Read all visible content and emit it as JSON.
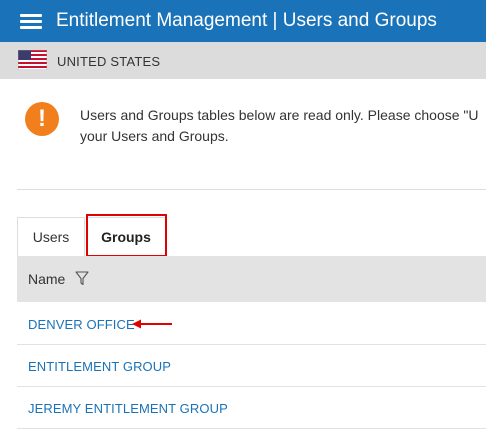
{
  "header": {
    "title": "Entitlement Management | Users and Groups",
    "background_color": "#1a73b8",
    "menu_icon": "hamburger-icon"
  },
  "region": {
    "flag_icon": "us-flag-icon",
    "label": "UNITED STATES"
  },
  "notice": {
    "icon": "exclamation-icon",
    "icon_color": "#f07f1c",
    "line1": "Users and Groups tables below are read only. Please choose \"U",
    "line2": "your Users and Groups."
  },
  "tabs": [
    {
      "label": "Users",
      "active": false
    },
    {
      "label": "Groups",
      "active": true
    }
  ],
  "grid": {
    "columns": [
      {
        "label": "Name",
        "filter_icon": "filter-icon"
      }
    ],
    "rows": [
      {
        "name": "DENVER OFFICE"
      },
      {
        "name": "ENTITLEMENT GROUP"
      },
      {
        "name": "JEREMY ENTITLEMENT GROUP"
      }
    ]
  },
  "annotations": {
    "highlight_color": "#e00000"
  }
}
